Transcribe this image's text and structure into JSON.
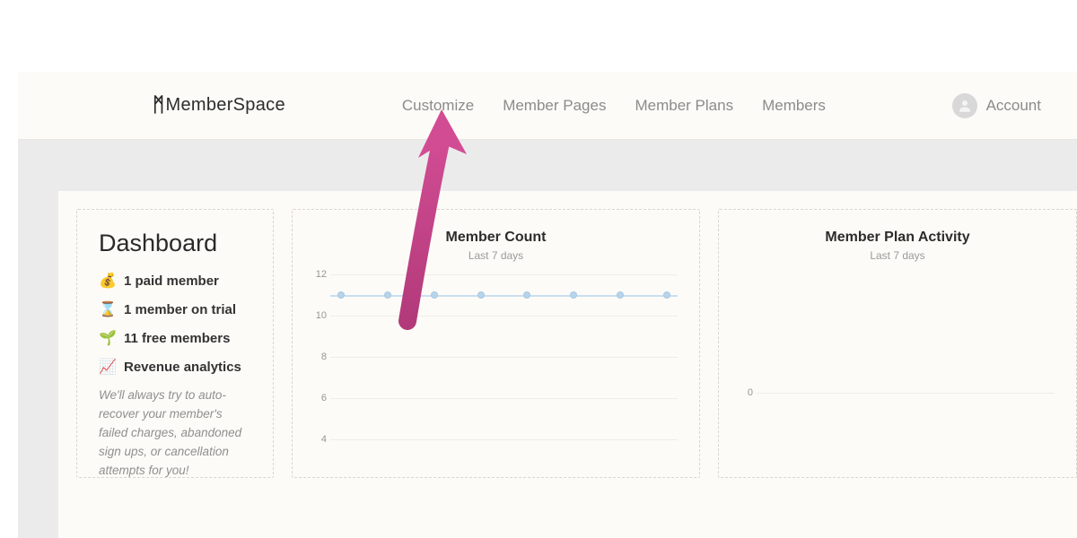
{
  "brand": "MemberSpace",
  "nav": {
    "customize": "Customize",
    "member_pages": "Member Pages",
    "member_plans": "Member Plans",
    "members": "Members"
  },
  "account_label": "Account",
  "dashboard": {
    "title": "Dashboard",
    "items": [
      {
        "icon": "💰",
        "label": "1 paid member"
      },
      {
        "icon": "⌛",
        "label": "1 member on trial"
      },
      {
        "icon": "🌱",
        "label": "11 free members"
      },
      {
        "icon": "📈",
        "label": "Revenue analytics"
      }
    ],
    "note": "We'll always try to auto-recover your member's failed charges, abandoned sign ups, or cancellation attempts for you!"
  },
  "chart1": {
    "title": "Member Count",
    "subtitle": "Last 7 days"
  },
  "chart2": {
    "title": "Member Plan Activity",
    "subtitle": "Last 7 days",
    "ticks": [
      "0"
    ]
  },
  "chart_data": [
    {
      "type": "line",
      "title": "Member Count",
      "subtitle": "Last 7 days",
      "y_ticks": [
        12,
        10,
        8,
        6,
        4
      ],
      "ylim": [
        4,
        12
      ],
      "series": [
        {
          "name": "members",
          "values": [
            11,
            11,
            11,
            11,
            11,
            11,
            11,
            11
          ]
        }
      ],
      "point_count": 8
    },
    {
      "type": "line",
      "title": "Member Plan Activity",
      "subtitle": "Last 7 days",
      "y_ticks": [
        0
      ],
      "series": []
    }
  ]
}
